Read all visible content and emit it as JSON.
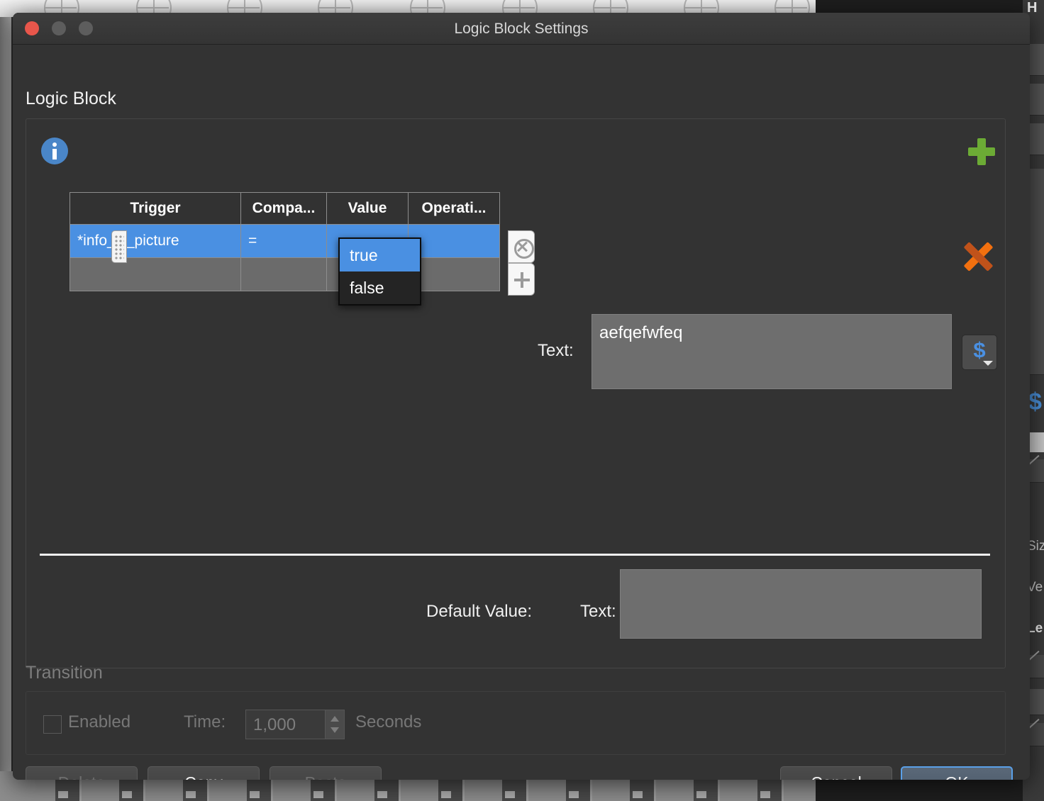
{
  "window": {
    "title": "Logic Block Settings",
    "traffic_lights": [
      "close",
      "minimize",
      "zoom"
    ]
  },
  "section": {
    "title": "Logic Block",
    "info_icon": "info-icon",
    "add_icon": "plus-icon",
    "delete_icon": "x-icon"
  },
  "table": {
    "columns": [
      "Trigger",
      "Compa...",
      "Value",
      "Operati..."
    ],
    "rows": [
      {
        "trigger": "*info_w_picture",
        "compare": "=",
        "value": "",
        "operation": "",
        "selected": true
      },
      {
        "trigger": "",
        "compare": "",
        "value": "",
        "operation": "",
        "selected": false
      }
    ],
    "row_remove_icon": "remove-circle-icon",
    "row_add_icon": "plus-icon",
    "drag_handle_icon": "drag-handle-icon"
  },
  "dropdown": {
    "open": true,
    "options": [
      "true",
      "false"
    ],
    "selected": "true"
  },
  "text_field": {
    "label": "Text:",
    "value": "aefqefwfeq",
    "placeholder": "",
    "variable_button_icon": "dollar-sign-icon"
  },
  "default_value": {
    "label": "Default Value:",
    "text_label": "Text:",
    "value": "",
    "placeholder": ""
  },
  "transition": {
    "title": "Transition",
    "enabled_label": "Enabled",
    "enabled_checked": false,
    "time_label": "Time:",
    "time_value": "1,000",
    "seconds_label": "Seconds"
  },
  "footer": {
    "delete_label": "Delete",
    "copy_label": "Copy",
    "paste_label": "Paste",
    "cancel_label": "Cancel",
    "ok_label": "OK"
  },
  "background": {
    "right_panel_title": "H",
    "right_panel_labels": [
      "Siz",
      "Ve",
      "Le"
    ],
    "dollar_glyph": "$"
  },
  "colors": {
    "accent_blue": "#4a90e2",
    "window_bg": "#333333",
    "field_bg": "#6e6e6e",
    "green_plus": "#6cab35",
    "orange_x": "#f2700f",
    "info_blue": "#4a86c8",
    "close_red": "#e8564b"
  }
}
